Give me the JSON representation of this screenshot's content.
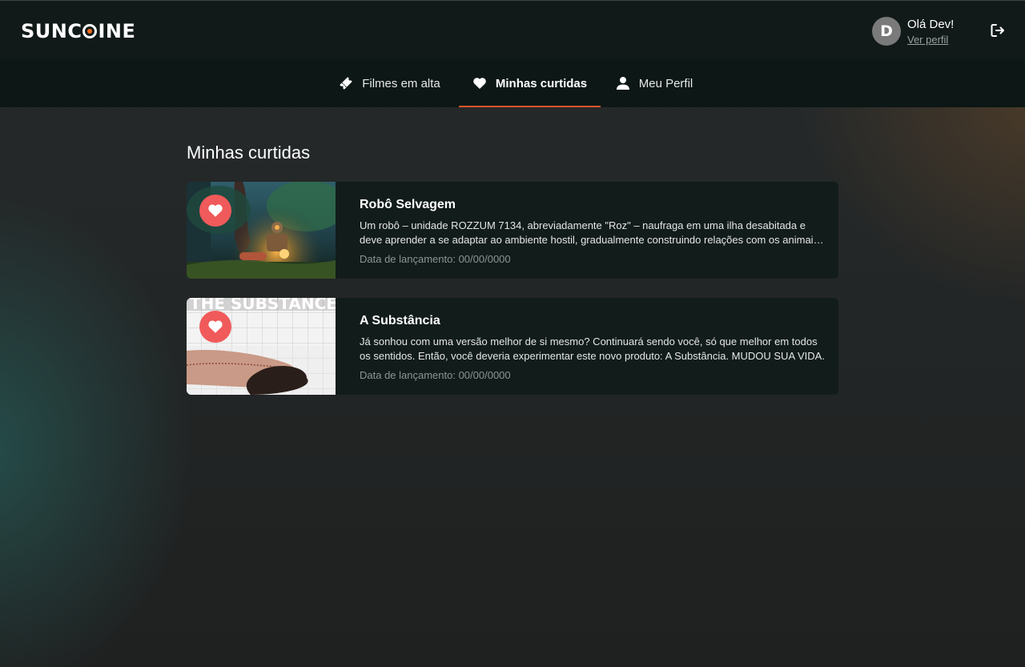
{
  "app": {
    "logo_text_before": "SUNC",
    "logo_text_after": "INE",
    "brand_accent": "#f26b1d"
  },
  "user": {
    "avatar_initial": "D",
    "greeting": "Olá Dev!",
    "profile_link": "Ver perfil"
  },
  "nav": {
    "items": [
      {
        "label": "Filmes em alta",
        "icon": "ticket-icon",
        "active": false
      },
      {
        "label": "Minhas curtidas",
        "icon": "heart-icon",
        "active": true
      },
      {
        "label": "Meu Perfil",
        "icon": "user-icon",
        "active": false
      }
    ],
    "active_underline_color": "#e0542b"
  },
  "main": {
    "title": "Minhas curtidas",
    "movies": [
      {
        "title": "Robô Selvagem",
        "description": "Um robô – unidade ROZZUM 7134, abreviadamente \"Roz\" – naufraga em uma ilha desabitada e deve aprender a se adaptar ao ambiente hostil, gradualmente construindo relações com os animais da ilha.",
        "date": "Data de lançamento: 00/00/0000",
        "liked": true
      },
      {
        "title": "A Substância",
        "description": "Já sonhou com uma versão melhor de si mesmo? Continuará sendo você, só que melhor em todos os sentidos. Então, você deveria experimentar este novo produto: A Substância. MUDOU SUA VIDA.",
        "date": "Data de lançamento: 00/00/0000",
        "poster_text": "THE SUBSTANCE",
        "liked": true
      }
    ],
    "like_color": "#f05a5a"
  }
}
